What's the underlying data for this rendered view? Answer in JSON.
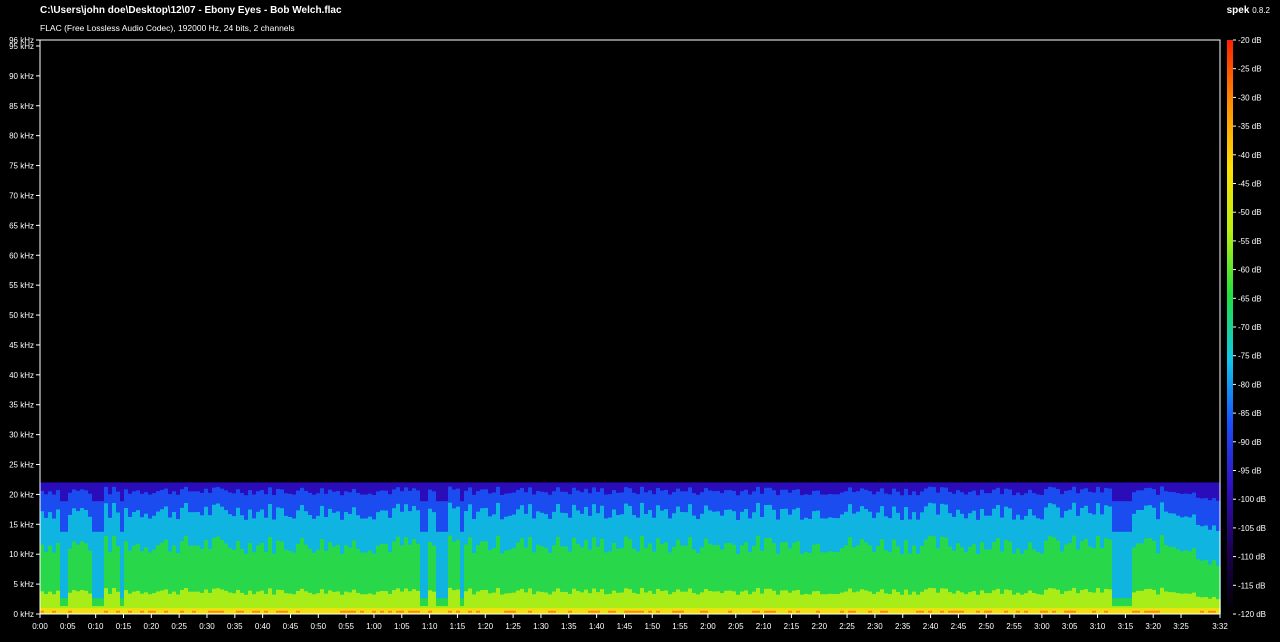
{
  "header": {
    "file_path": "C:\\Users\\john doe\\Desktop\\12\\07 - Ebony Eyes - Bob Welch.flac",
    "file_info": "FLAC (Free Lossless Audio Codec), 192000 Hz, 24 bits, 2 channels",
    "app_name": "spek",
    "app_version": "0.8.2"
  },
  "colors": {
    "background": "#000000",
    "axis": "#ffffff",
    "scale": [
      "#000000",
      "#1e0053",
      "#3010c0",
      "#1a50ff",
      "#10c8e8",
      "#20e040",
      "#b8f010",
      "#ffe000",
      "#ff9000",
      "#ff2000"
    ]
  },
  "chart_data": {
    "type": "heatmap",
    "xlabel": "",
    "ylabel": "",
    "x_unit": "time (m:ss)",
    "y_unit": "kHz",
    "xlim_seconds": [
      0,
      212
    ],
    "ylim_khz": [
      0,
      96
    ],
    "x_ticks": [
      "0:00",
      "0:05",
      "0:10",
      "0:15",
      "0:20",
      "0:25",
      "0:30",
      "0:35",
      "0:40",
      "0:45",
      "0:50",
      "0:55",
      "1:00",
      "1:05",
      "1:10",
      "1:15",
      "1:20",
      "1:25",
      "1:30",
      "1:35",
      "1:40",
      "1:45",
      "1:50",
      "1:55",
      "2:00",
      "2:05",
      "2:10",
      "2:15",
      "2:20",
      "2:25",
      "2:30",
      "2:35",
      "2:40",
      "2:45",
      "2:50",
      "2:55",
      "3:00",
      "3:05",
      "3:10",
      "3:15",
      "3:20",
      "3:25",
      "3:32"
    ],
    "y_ticks": [
      "0 kHz",
      "5 kHz",
      "10 kHz",
      "15 kHz",
      "20 kHz",
      "25 kHz",
      "30 kHz",
      "35 kHz",
      "40 kHz",
      "45 kHz",
      "50 kHz",
      "55 kHz",
      "60 kHz",
      "65 kHz",
      "70 kHz",
      "75 kHz",
      "80 kHz",
      "85 kHz",
      "90 kHz",
      "95 kHz",
      "96 kHz"
    ],
    "db_ticks": [
      "-20 dB",
      "-25 dB",
      "-30 dB",
      "-35 dB",
      "-40 dB",
      "-45 dB",
      "-50 dB",
      "-55 dB",
      "-60 dB",
      "-65 dB",
      "-70 dB",
      "-75 dB",
      "-80 dB",
      "-85 dB",
      "-90 dB",
      "-95 dB",
      "-100 dB",
      "-105 dB",
      "-110 dB",
      "-115 dB",
      "-120 dB"
    ],
    "db_range": [
      -120,
      -20
    ],
    "content_cutoff_khz": 22,
    "dropouts_seconds": [
      [
        3,
        5
      ],
      [
        9,
        11
      ],
      [
        14,
        15
      ],
      [
        68,
        69
      ],
      [
        71,
        73
      ],
      [
        75,
        76
      ],
      [
        192,
        194
      ],
      [
        194,
        196
      ]
    ],
    "legend": "right"
  }
}
